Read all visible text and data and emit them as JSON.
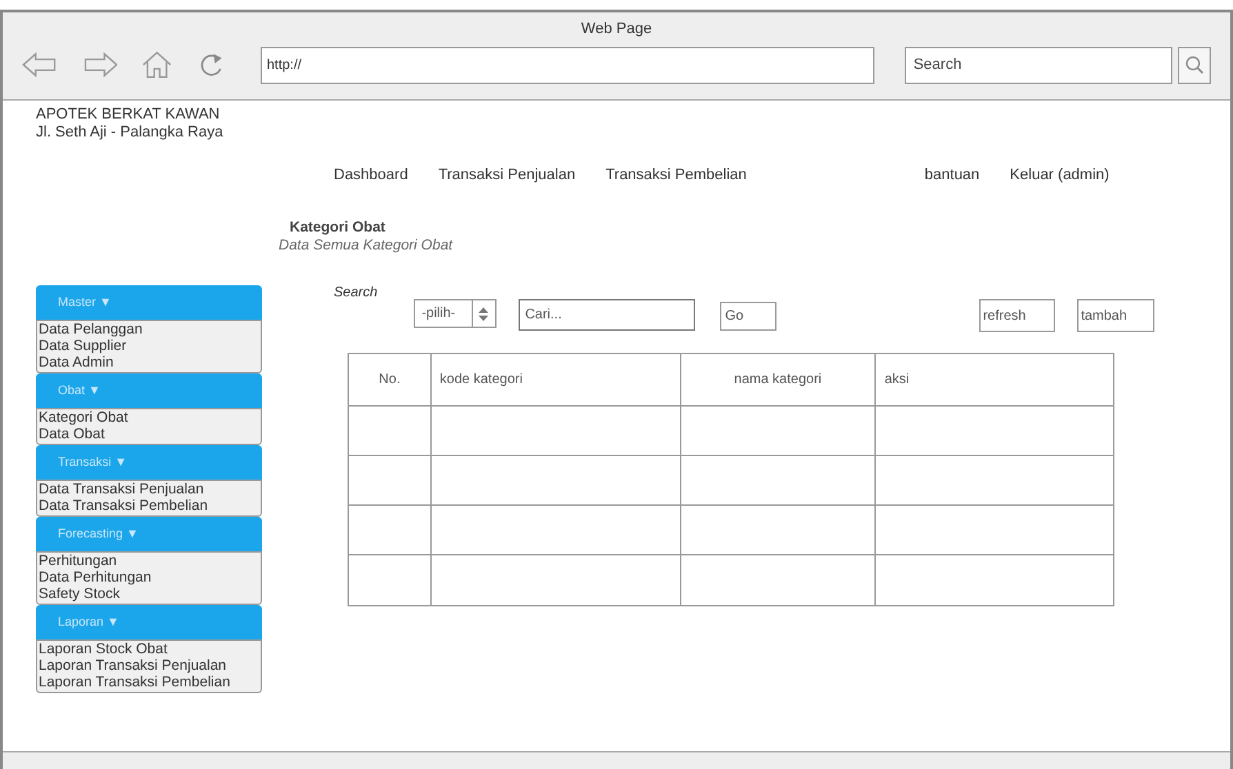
{
  "window": {
    "title": "Web Page"
  },
  "toolbar": {
    "url": "http://",
    "search_placeholder": "Search"
  },
  "header": {
    "name": "APOTEK BERKAT KAWAN",
    "address": "Jl. Seth Aji - Palangka Raya"
  },
  "nav": [
    "Dashboard",
    "Transaksi Penjualan",
    "Transaksi Pembelian",
    "bantuan",
    "Keluar (admin)"
  ],
  "page": {
    "title": "Kategori Obat",
    "subtitle": "Data Semua Kategori Obat"
  },
  "sidebar": [
    {
      "title": "Master ▼",
      "items": [
        "Data Pelanggan",
        "Data Supplier",
        "Data Admin"
      ]
    },
    {
      "title": "Obat ▼",
      "items": [
        "Kategori Obat",
        "Data Obat"
      ]
    },
    {
      "title": "Transaksi ▼",
      "items": [
        "Data Transaksi Penjualan",
        "Data Transaksi Pembelian"
      ]
    },
    {
      "title": "Forecasting ▼",
      "items": [
        "Perhitungan",
        "Data Perhitungan",
        "Safety Stock"
      ]
    },
    {
      "title": "Laporan ▼",
      "items": [
        "Laporan Stock Obat",
        "Laporan Transaksi Penjualan",
        "Laporan Transaksi Pembelian"
      ]
    }
  ],
  "filter": {
    "label": "Search",
    "select_value": "-pilih-",
    "query_placeholder": "Cari...",
    "go": "Go",
    "buttons": [
      "refresh",
      "tambah"
    ]
  },
  "table": {
    "columns": [
      {
        "label": "No."
      },
      {
        "label": "kode kategori"
      },
      {
        "label": "nama kategori"
      },
      {
        "label": "aksi"
      }
    ]
  }
}
